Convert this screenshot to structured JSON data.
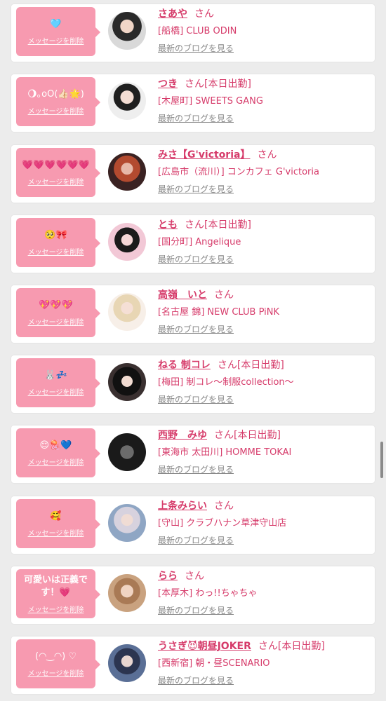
{
  "favorites": [
    {
      "message": "🩵",
      "delete_label": "メッセージを削除",
      "name": "さあや",
      "honorific": "さん",
      "status": "",
      "place": "[船橋] CLUB ODIN",
      "blog_link": "最新のブログを見る",
      "avatar_color": "#d9d9d9"
    },
    {
      "message": "🌖｡oO(👍🏻🌟)",
      "delete_label": "メッセージを削除",
      "name": "つき",
      "honorific": "さん",
      "status": "[本日出勤]",
      "place": "[木屋町] SWEETS GANG",
      "blog_link": "最新のブログを見る",
      "avatar_color": "#eeeeee"
    },
    {
      "message": "💗💗💗💗💗💗",
      "delete_label": "メッセージを削除",
      "name": "みさ【G'victoria】",
      "honorific": "さん",
      "status": "",
      "place": "[広島市（流川）] コンカフェ G'victoria",
      "blog_link": "最新のブログを見る",
      "avatar_color": "#4b2f2f"
    },
    {
      "message": "🥺🎀",
      "delete_label": "メッセージを削除",
      "name": "とも",
      "honorific": "さん",
      "status": "[本日出勤]",
      "place": "[国分町] Angelique",
      "blog_link": "最新のブログを見る",
      "avatar_color": "#f2c8d6"
    },
    {
      "message": "💖💖💖",
      "delete_label": "メッセージを削除",
      "name": "高嶺　いと",
      "honorific": "さん",
      "status": "",
      "place": "[名古屋 錦] NEW CLUB PiNK",
      "blog_link": "最新のブログを見る",
      "avatar_color": "#f7efe8"
    },
    {
      "message": "🐰💤",
      "delete_label": "メッセージを削除",
      "name": "ねる 制コレ",
      "honorific": "さん",
      "status": "[本日出勤]",
      "place": "[梅田] 制コレ〜制服collection〜",
      "blog_link": "最新のブログを見る",
      "avatar_color": "#3a3030"
    },
    {
      "message": "😌🪼💙",
      "delete_label": "メッセージを削除",
      "name": "西野　みゆ",
      "honorific": "さん",
      "status": "[本日出勤]",
      "place": "[東海市 太田川] HOMME TOKAI",
      "blog_link": "最新のブログを見る",
      "avatar_color": "#2b2b2b"
    },
    {
      "message": "🥰",
      "delete_label": "メッセージを削除",
      "name": "上条みらい",
      "honorific": "さん",
      "status": "",
      "place": "[守山] クラブハナン草津守山店",
      "blog_link": "最新のブログを見る",
      "avatar_color": "#8fa6c4"
    },
    {
      "message": "可愛いは正義です！💗",
      "delete_label": "メッセージを削除",
      "name": "らら",
      "honorific": "さん",
      "status": "",
      "place": "[本厚木] わっ!!ちゃちゃ",
      "blog_link": "最新のブログを見る",
      "avatar_color": "#c9a27f"
    },
    {
      "message": "(◠‿◠) ♡",
      "delete_label": "メッセージを削除",
      "name": "うさぎ😈朝昼JOKER",
      "honorific": "さん",
      "status": "[本日出勤]",
      "place": "[西新宿] 朝・昼SCENARIO",
      "blog_link": "最新のブログを見る",
      "avatar_color": "#5a6f96"
    }
  ]
}
